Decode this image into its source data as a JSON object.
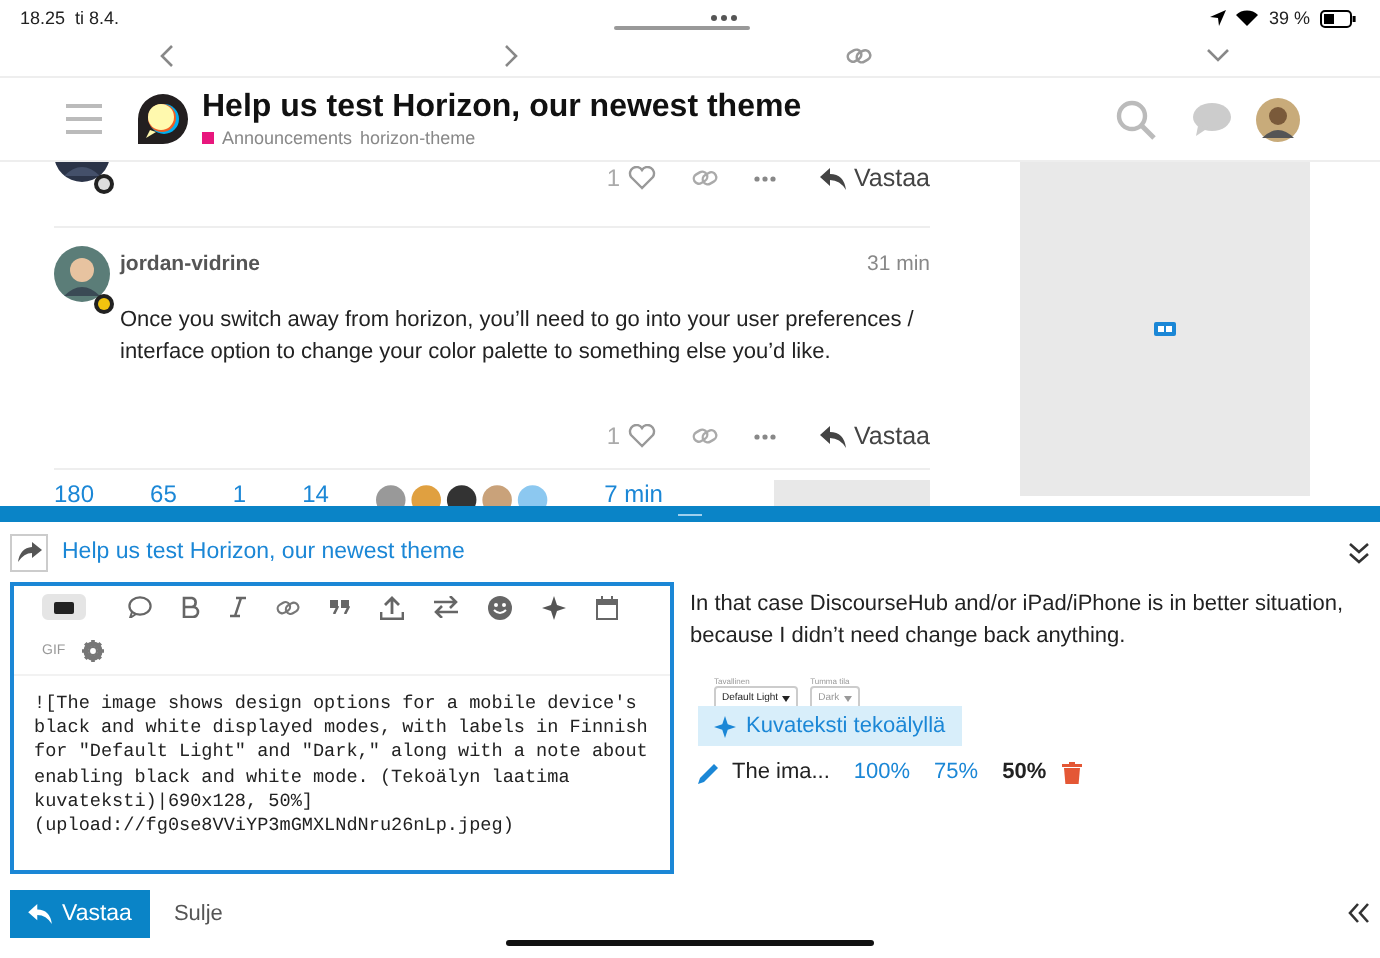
{
  "status_bar": {
    "time": "18.25",
    "date": "ti 8.4.",
    "battery": "39 %"
  },
  "topic": {
    "title": "Help us test Horizon, our newest theme",
    "category": {
      "name": "Announcements",
      "color": "#e8177d"
    },
    "tag": "horizon-theme"
  },
  "posts": [
    {
      "likes": "1",
      "reply": "Vastaa"
    },
    {
      "author": "jordan-vidrine",
      "time": "31 min",
      "body": "Once you switch away from horizon, you’ll need to go into your user preferences / interface option to change your color palette to something else you’d like.",
      "likes": "1",
      "reply": "Vastaa"
    }
  ],
  "topic_stats": [
    "180",
    "65",
    "1",
    "14"
  ],
  "topic_stats_time": "7 min",
  "composer": {
    "reply_to": "Help us test Horizon, our newest theme",
    "editor_text": "![The image shows design options for a mobile device's black and white displayed modes, with labels in Finnish for \"Default Light\" and \"Dark,\" along with a note about enabling black and white mode. (Tekoälyn laatima kuvateksti)|690x128, 50%](upload://fg0se8VViYP3mGMXLNdNru26nLp.jpeg)",
    "gif_label": "GIF",
    "markdown_mode": true,
    "submit": "Vastaa",
    "close": "Sulje",
    "preview_text": "In that case DiscourseHub and/or iPad/iPhone is in better situation, because I didn’t need change back anything.",
    "preview_image": {
      "fields": [
        {
          "label": "Tavallinen",
          "value": "Default Light"
        },
        {
          "label": "Tumma tila",
          "value": "Dark"
        }
      ]
    },
    "ai_caption": "Kuvateksti tekoälyllä",
    "image_caption": "The ima...",
    "sizes": [
      {
        "label": "100%",
        "selected": false
      },
      {
        "label": "75%",
        "selected": false
      },
      {
        "label": "50%",
        "selected": true
      }
    ]
  }
}
